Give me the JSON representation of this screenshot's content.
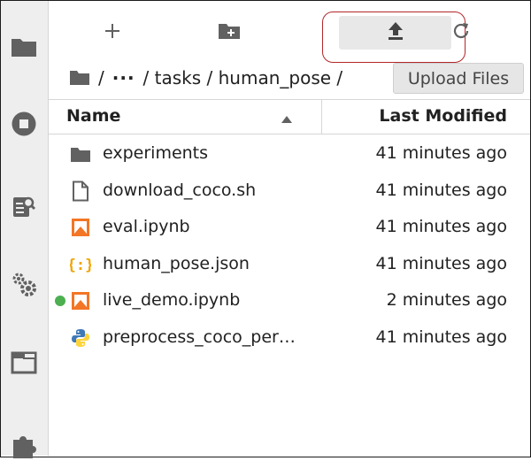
{
  "colors": {
    "accent_border": "#b3262a",
    "running_dot": "#4caf50",
    "notebook_orange": "#f37626",
    "json_orange": "#f0a400",
    "python_blue": "#3f7ab7",
    "python_yellow": "#fdd43a",
    "icon_gray": "#616161"
  },
  "sidebar": {
    "items": [
      {
        "icon": "folder-icon"
      },
      {
        "icon": "running-stop-icon"
      },
      {
        "icon": "property-inspector-icon"
      },
      {
        "icon": "settings-gears-icon"
      },
      {
        "icon": "tab-window-icon"
      },
      {
        "icon": "extension-puzzle-icon"
      }
    ]
  },
  "toolbar": {
    "new_launcher_icon": "plus-icon",
    "new_folder_icon": "new-folder-icon",
    "upload_icon": "upload-icon",
    "refresh_icon": "refresh-icon",
    "tooltip": "Upload Files"
  },
  "breadcrumb": {
    "root_icon": "folder-icon",
    "sep1": "/",
    "ellipsis": "···",
    "path": "/ tasks / human_pose /"
  },
  "table": {
    "col_name": "Name",
    "col_modified": "Last Modified",
    "rows": [
      {
        "name": "experiments",
        "modified": "41 minutes ago",
        "icon": "folder-icon",
        "running": false
      },
      {
        "name": "download_coco.sh",
        "modified": "41 minutes ago",
        "icon": "file-icon",
        "running": false
      },
      {
        "name": "eval.ipynb",
        "modified": "41 minutes ago",
        "icon": "notebook-icon",
        "running": false
      },
      {
        "name": "human_pose.json",
        "modified": "41 minutes ago",
        "icon": "json-icon",
        "running": false
      },
      {
        "name": "live_demo.ipynb",
        "modified": "2 minutes ago",
        "icon": "notebook-icon",
        "running": true
      },
      {
        "name": "preprocess_coco_per…",
        "modified": "41 minutes ago",
        "icon": "python-icon",
        "running": false
      }
    ]
  }
}
